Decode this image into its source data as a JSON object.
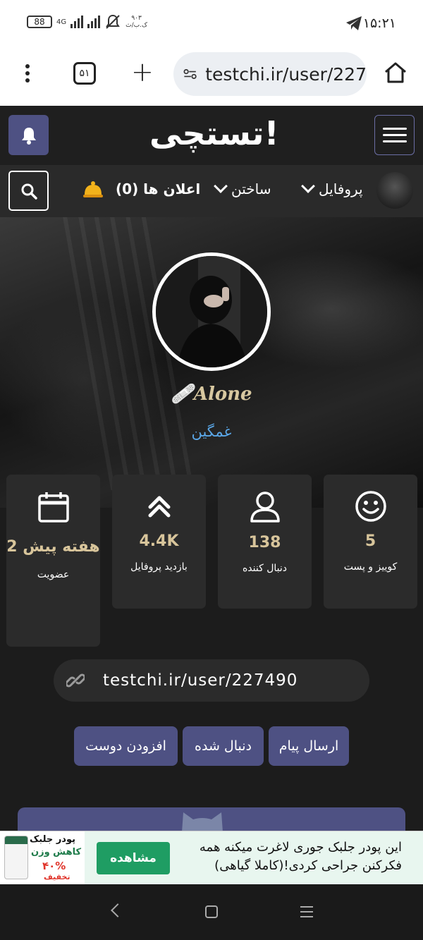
{
  "statusbar": {
    "time": "۱۵:۲۱",
    "battery": "88",
    "network": "4G",
    "speed_value": "۹۰۳",
    "speed_unit": "ک.ب/ث"
  },
  "browser": {
    "tabs_count": "۵۱",
    "url": "testchi.ir/user/227"
  },
  "site": {
    "logo": "تستچی!",
    "nav": {
      "profile": "پروفایل",
      "build": "ساختن",
      "notifications": "اعلان ها (0)"
    }
  },
  "profile": {
    "username": "Alone",
    "username_emoji": "🩹",
    "status": "غمگین",
    "link": "testchi.ir/user/227490"
  },
  "stats": [
    {
      "value": "5",
      "label": "کوییز و پست",
      "icon": "smiley-icon"
    },
    {
      "value": "138",
      "label": "دنبال کننده",
      "icon": "user-icon"
    },
    {
      "value": "4.4K",
      "label": "بازدید پروفایل",
      "icon": "double-chevron-up-icon"
    },
    {
      "value": "2 هفته پیش",
      "label": "عضویت",
      "icon": "calendar-icon"
    }
  ],
  "actions": {
    "send_message": "ارسال پیام",
    "followed": "دنبال شده",
    "add_friend": "افزودن دوست"
  },
  "ad": {
    "title": "پودر جلبک",
    "subtitle": "کاهش وزن",
    "discount": "۴۰%",
    "discount_label": "تخفیف",
    "button": "مشاهده",
    "text": "این پودر جلبک جوری لاغرت میکنه همه فکرکنن جراحی کردی!(کاملا گیاهی)"
  },
  "colors": {
    "accent": "#4e5183",
    "stat_value": "#d8c59b",
    "status_link": "#5aa6e6",
    "ad_button": "#1f9d63"
  }
}
